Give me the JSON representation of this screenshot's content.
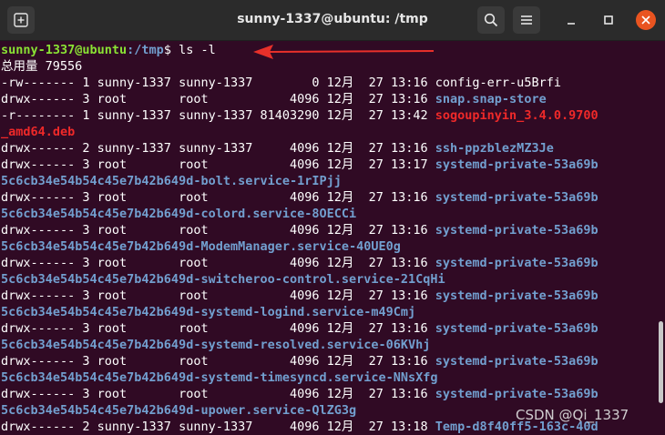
{
  "window": {
    "title": "sunny-1337@ubuntu: /tmp",
    "new_tab_icon": "new-tab-icon",
    "search_icon": "search-icon",
    "menu_icon": "hamburger-icon"
  },
  "terminal": {
    "prompt_user": "sunny-1337@ubuntu",
    "prompt_path": ":/tmp",
    "prompt_suffix": "$ ls -l",
    "total": "总用量 79556",
    "lines": [
      {
        "prefix": "-rw------- 1 sunny-1337 sunny-1337        0 12月  27 13:16 ",
        "name": "config-err-u5Brfi",
        "cls": "plain"
      },
      {
        "prefix": "drwx------ 3 root       root           4096 12月  27 13:16 ",
        "name": "snap.snap-store",
        "cls": "blue"
      },
      {
        "prefix": "-r-------- 1 sunny-1337 sunny-1337 81403290 12月  27 13:42 ",
        "name": "sogoupinyin_3.4.0.9700",
        "cls": "red"
      },
      {
        "prefix": "",
        "name": "_amd64.deb",
        "cls": "red"
      },
      {
        "prefix": "drwx------ 2 sunny-1337 sunny-1337     4096 12月  27 13:16 ",
        "name": "ssh-ppzblezMZ3Je",
        "cls": "blue"
      },
      {
        "prefix": "drwx------ 3 root       root           4096 12月  27 13:17 ",
        "name": "systemd-private-53a69b",
        "cls": "blue"
      },
      {
        "prefix": "",
        "name": "5c6cb34e54b54c45e7b42b649d-bolt.service-1rIPjj",
        "cls": "dim"
      },
      {
        "prefix": "drwx------ 3 root       root           4096 12月  27 13:16 ",
        "name": "systemd-private-53a69b",
        "cls": "blue"
      },
      {
        "prefix": "",
        "name": "5c6cb34e54b54c45e7b42b649d-colord.service-8OECCi",
        "cls": "dim"
      },
      {
        "prefix": "drwx------ 3 root       root           4096 12月  27 13:16 ",
        "name": "systemd-private-53a69b",
        "cls": "blue"
      },
      {
        "prefix": "",
        "name": "5c6cb34e54b54c45e7b42b649d-ModemManager.service-40UE0g",
        "cls": "dim"
      },
      {
        "prefix": "drwx------ 3 root       root           4096 12月  27 13:16 ",
        "name": "systemd-private-53a69b",
        "cls": "blue"
      },
      {
        "prefix": "",
        "name": "5c6cb34e54b54c45e7b42b649d-switcheroo-control.service-21CqHi",
        "cls": "dim"
      },
      {
        "prefix": "drwx------ 3 root       root           4096 12月  27 13:16 ",
        "name": "systemd-private-53a69b",
        "cls": "blue"
      },
      {
        "prefix": "",
        "name": "5c6cb34e54b54c45e7b42b649d-systemd-logind.service-m49Cmj",
        "cls": "dim"
      },
      {
        "prefix": "drwx------ 3 root       root           4096 12月  27 13:16 ",
        "name": "systemd-private-53a69b",
        "cls": "blue"
      },
      {
        "prefix": "",
        "name": "5c6cb34e54b54c45e7b42b649d-systemd-resolved.service-06KVhj",
        "cls": "dim"
      },
      {
        "prefix": "drwx------ 3 root       root           4096 12月  27 13:16 ",
        "name": "systemd-private-53a69b",
        "cls": "blue"
      },
      {
        "prefix": "",
        "name": "5c6cb34e54b54c45e7b42b649d-systemd-timesyncd.service-NNsXfg",
        "cls": "dim"
      },
      {
        "prefix": "drwx------ 3 root       root           4096 12月  27 13:16 ",
        "name": "systemd-private-53a69b",
        "cls": "blue"
      },
      {
        "prefix": "",
        "name": "5c6cb34e54b54c45e7b42b649d-upower.service-QlZG3g",
        "cls": "dim"
      },
      {
        "prefix": "drwx------ 2 sunny-1337 sunny-1337     4096 12月  27 13:18 ",
        "name": "Temp-d8f40ff5-163c-40d",
        "cls": "blue"
      }
    ]
  },
  "watermark": "CSDN @Qi_1337",
  "colors": {
    "background": "#300a24",
    "green": "#8ae234",
    "blue": "#729fcf",
    "red": "#ef2929",
    "arrow": "#e8302a"
  }
}
